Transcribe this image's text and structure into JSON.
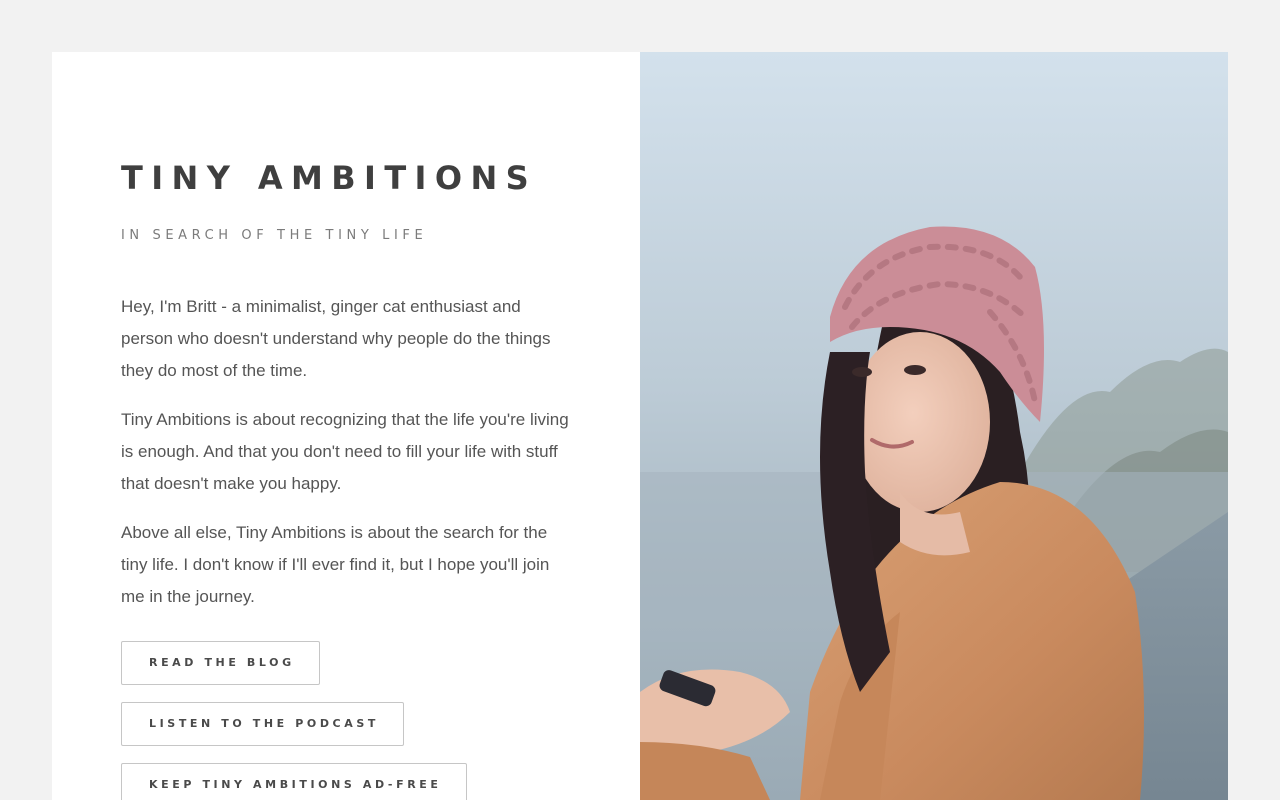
{
  "site": {
    "title": "TINY AMBITIONS",
    "tagline": "IN SEARCH OF THE TINY LIFE"
  },
  "intro": {
    "paragraphs": [
      "Hey, I'm Britt - a minimalist, ginger cat enthusiast and person who doesn't understand why people do the things they do most of the time.",
      "Tiny Ambitions is about recognizing that the life you're living is enough. And that you don't need to fill your life with stuff that doesn't make you happy.",
      "Above all else, Tiny Ambitions is about the search for the tiny life. I don't know if I'll ever find it, but I hope you'll join me in the journey."
    ]
  },
  "buttons": {
    "read_blog": "READ THE BLOG",
    "podcast": "LISTEN TO THE PODCAST",
    "ad_free": "KEEP TINY AMBITIONS AD-FREE"
  },
  "colors": {
    "page_background": "#f2f2f2",
    "card_background": "#ffffff",
    "title_text": "#3f3f3f",
    "tagline_text": "#7b7b7b",
    "body_text": "#555555",
    "button_border": "#c6c6c6"
  }
}
